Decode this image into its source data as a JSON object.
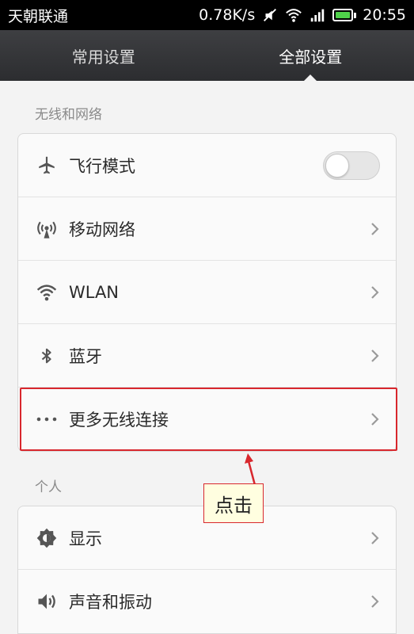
{
  "status_bar": {
    "carrier": "天朝联通",
    "speed": "0.78K/s",
    "time": "20:55",
    "icons": [
      "mute-icon",
      "wifi-icon",
      "signal-icon",
      "battery-icon"
    ]
  },
  "tabs": [
    {
      "label": "常用设置",
      "active": false
    },
    {
      "label": "全部设置",
      "active": true
    }
  ],
  "sections": [
    {
      "header": "无线和网络",
      "items": [
        {
          "label": "飞行模式",
          "icon": "airplane-icon",
          "control": "toggle",
          "toggle_on": false
        },
        {
          "label": "移动网络",
          "icon": "antenna-icon",
          "control": "chevron"
        },
        {
          "label": "WLAN",
          "icon": "wifi-icon",
          "control": "chevron"
        },
        {
          "label": "蓝牙",
          "icon": "bluetooth-icon",
          "control": "chevron"
        },
        {
          "label": "更多无线连接",
          "icon": "more-icon",
          "control": "chevron"
        }
      ]
    },
    {
      "header": "个人",
      "items": [
        {
          "label": "显示",
          "icon": "brightness-icon",
          "control": "chevron"
        },
        {
          "label": "声音和振动",
          "icon": "speaker-icon",
          "control": "chevron"
        }
      ]
    }
  ],
  "annotation": {
    "callout_text": "点击",
    "accent_color": "#d8272d"
  }
}
